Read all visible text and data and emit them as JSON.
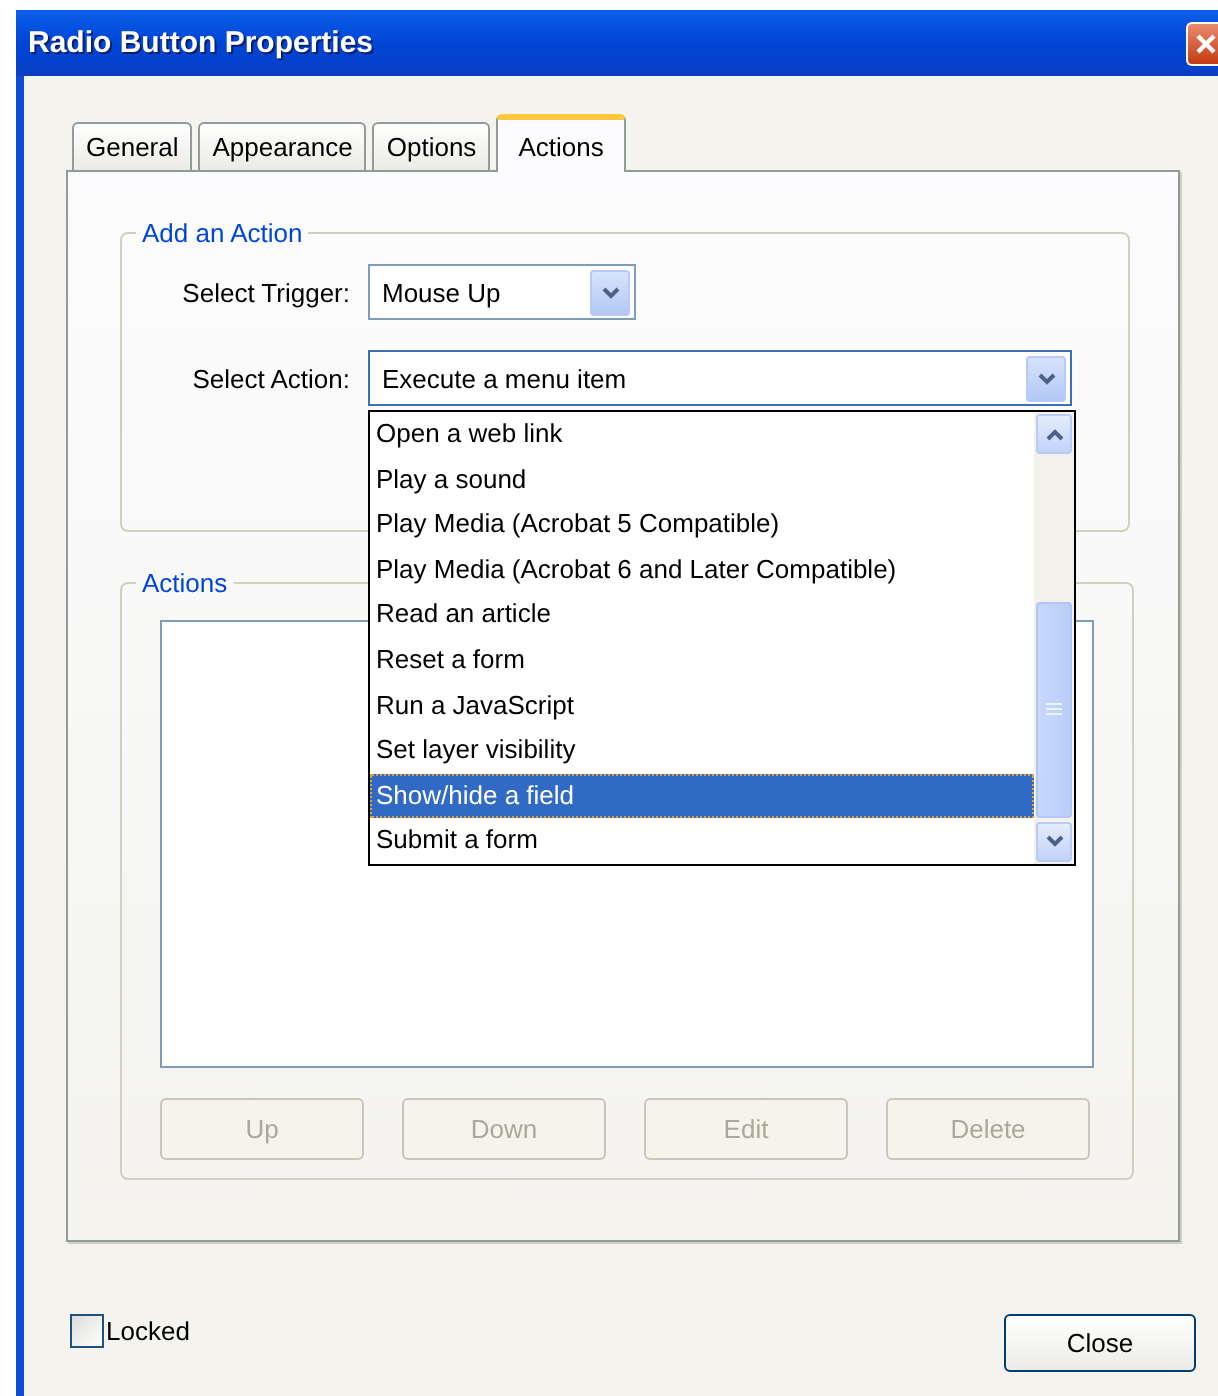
{
  "window": {
    "title": "Radio Button Properties"
  },
  "tabs": [
    {
      "label": "General",
      "selected": false
    },
    {
      "label": "Appearance",
      "selected": false
    },
    {
      "label": "Options",
      "selected": false
    },
    {
      "label": "Actions",
      "selected": true
    }
  ],
  "add_action": {
    "title": "Add an Action",
    "trigger": {
      "label": "Select Trigger:",
      "value": "Mouse Up"
    },
    "action": {
      "label": "Select Action:",
      "value": "Execute a menu item",
      "expanded": true,
      "options": [
        {
          "label": "Open a web link",
          "selected": false
        },
        {
          "label": "Play a sound",
          "selected": false
        },
        {
          "label": "Play Media (Acrobat 5 Compatible)",
          "selected": false
        },
        {
          "label": "Play Media (Acrobat 6 and Later Compatible)",
          "selected": false
        },
        {
          "label": "Read an article",
          "selected": false
        },
        {
          "label": "Reset a form",
          "selected": false
        },
        {
          "label": "Run a JavaScript",
          "selected": false
        },
        {
          "label": "Set layer visibility",
          "selected": false
        },
        {
          "label": "Show/hide a field",
          "selected": true
        },
        {
          "label": "Submit a form",
          "selected": false
        }
      ]
    }
  },
  "actions": {
    "title": "Actions",
    "buttons": [
      {
        "label": "Up",
        "disabled": true
      },
      {
        "label": "Down",
        "disabled": true
      },
      {
        "label": "Edit",
        "disabled": true
      },
      {
        "label": "Delete",
        "disabled": true
      }
    ]
  },
  "locked": {
    "label": "Locked",
    "checked": false
  },
  "close_button": "Close"
}
